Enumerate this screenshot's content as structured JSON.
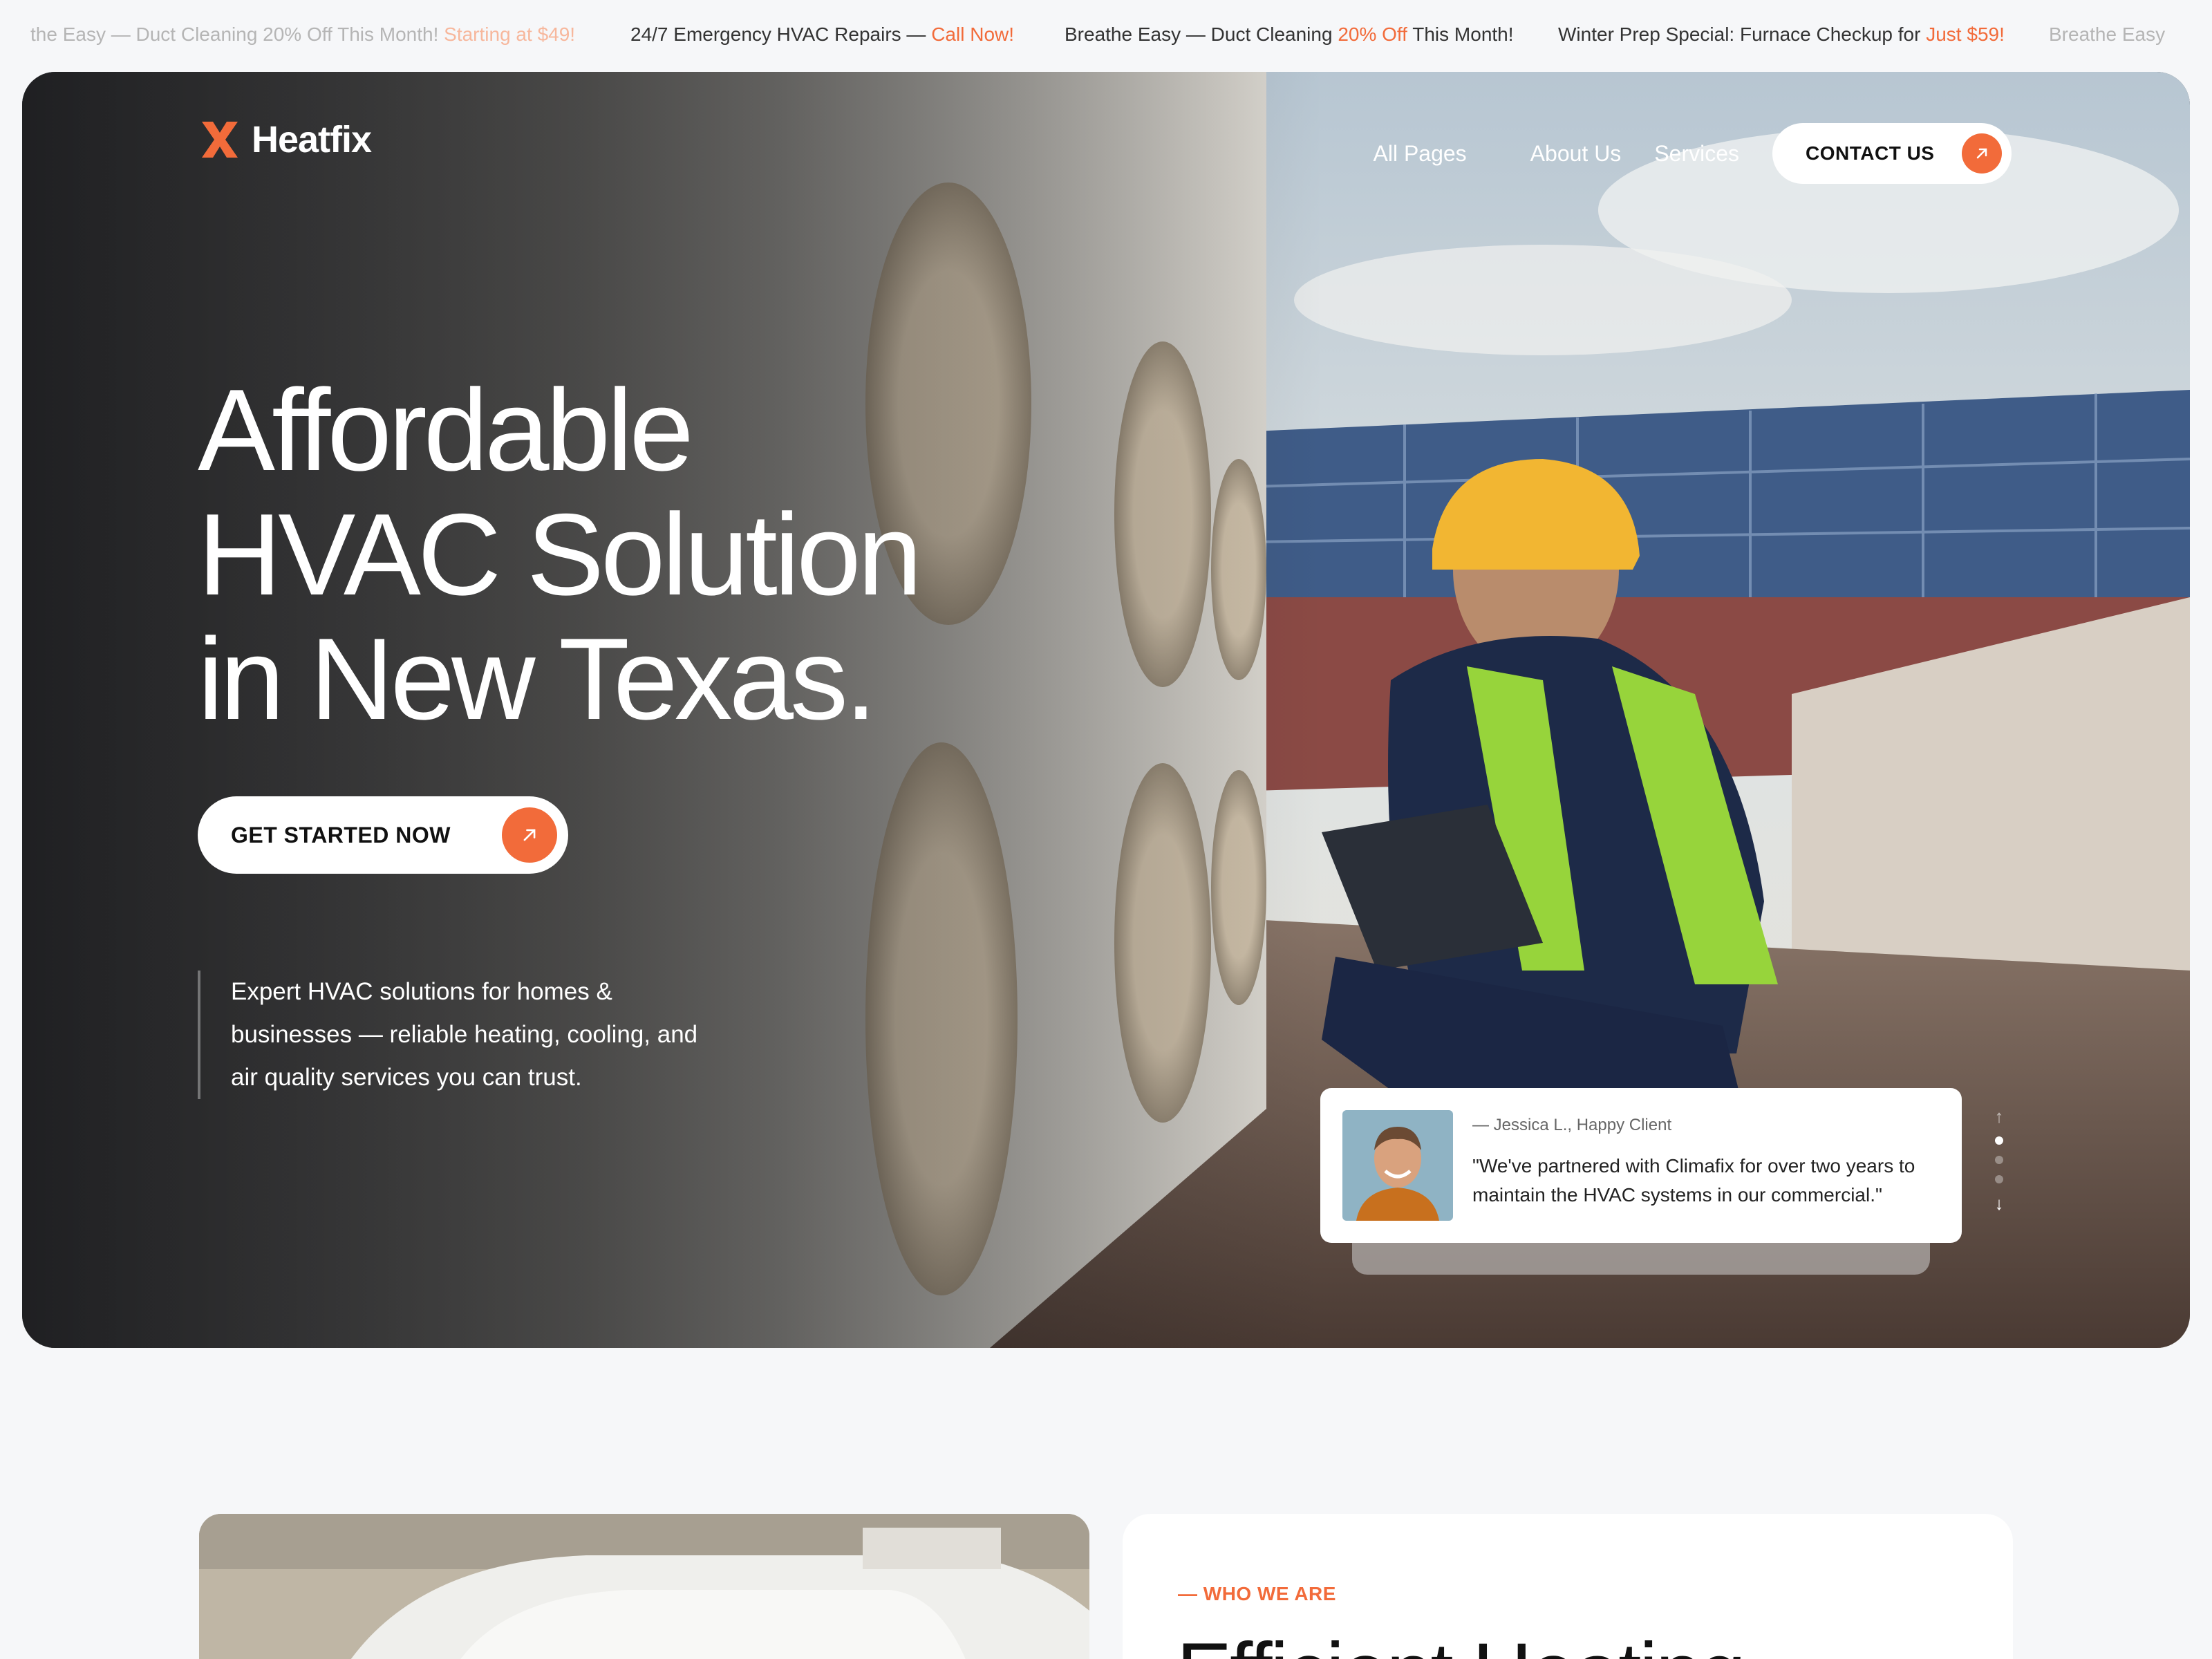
{
  "ticker": [
    {
      "text": "the Easy — Duct Cleaning 20% Off This Month! ",
      "highlight": "Starting at $49!"
    },
    {
      "text": "24/7 Emergency HVAC Repairs — ",
      "highlight": "Call Now!"
    },
    {
      "text_a": "Breathe Easy — Duct Cleaning ",
      "highlight": "20% Off",
      "text_b": " This Month!"
    },
    {
      "text": "Winter Prep Special: Furnace Checkup for ",
      "highlight": "Just $59!"
    },
    {
      "text": "Breathe Easy"
    }
  ],
  "brand": {
    "name": "Heatfix",
    "accent": "#f26b3a"
  },
  "nav": {
    "items": [
      "All Pages",
      "About Us",
      "Services"
    ],
    "contact_label": "CONTACT US"
  },
  "hero": {
    "headline_lines": [
      "Affordable",
      "HVAC Solution",
      "in New Texas."
    ],
    "cta_label": "GET STARTED NOW",
    "description": "Expert HVAC solutions for homes & businesses — reliable heating, cooling, and air quality services you can trust."
  },
  "testimonial": {
    "author": "— Jessica L., Happy Client",
    "quote": "\"We've partnered with Climafix for over two years to maintain the HVAC systems in our commercial.\""
  },
  "about": {
    "eyebrow": "— WHO WE ARE",
    "title": "Efficient Heating"
  }
}
